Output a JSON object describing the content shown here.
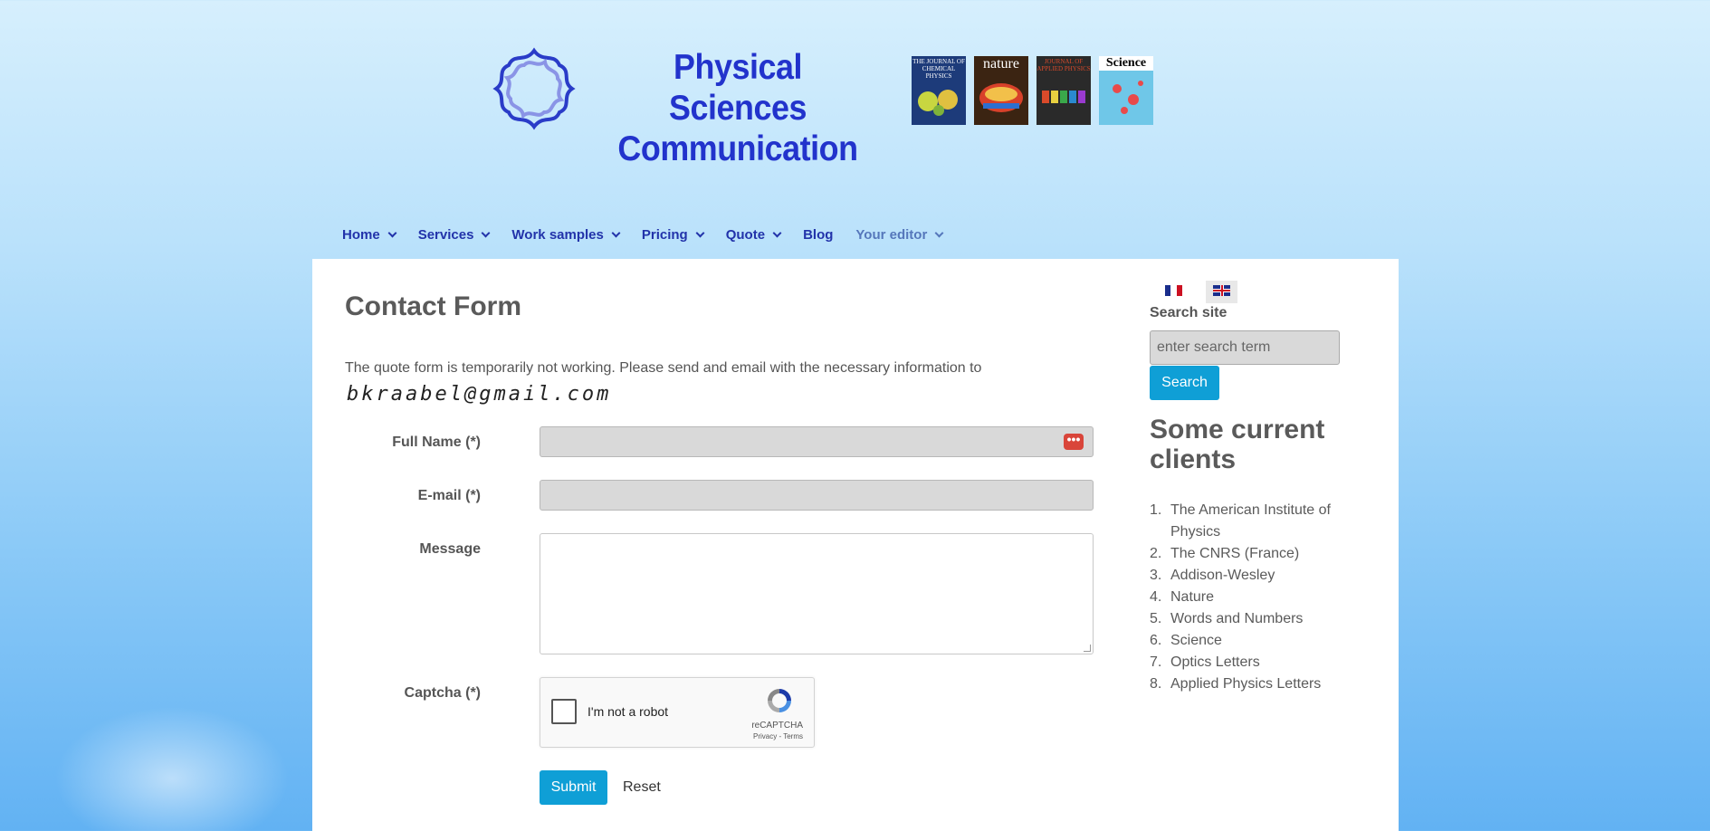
{
  "header": {
    "site_title_line1": "Physical Sciences",
    "site_title_line2": "Communication",
    "covers": [
      {
        "title": "THE JOURNAL OF CHEMICAL PHYSICS",
        "bg": "#1d3b7a",
        "fg": "#ffffff"
      },
      {
        "title": "nature",
        "bg": "#3b2412",
        "fg": "#ffffff"
      },
      {
        "title": "JOURNAL OF APPLIED PHYSICS",
        "bg": "#2a2a2a",
        "fg": "#d94a2a"
      },
      {
        "title": "Science",
        "bg": "#6fc7e8",
        "fg": "#000000"
      }
    ]
  },
  "nav": {
    "items": [
      {
        "label": "Home",
        "has_dropdown": true
      },
      {
        "label": "Services",
        "has_dropdown": true
      },
      {
        "label": "Work samples",
        "has_dropdown": true
      },
      {
        "label": "Pricing",
        "has_dropdown": true
      },
      {
        "label": "Quote",
        "has_dropdown": true
      },
      {
        "label": "Blog",
        "has_dropdown": false
      },
      {
        "label": "Your editor",
        "has_dropdown": true
      }
    ]
  },
  "main": {
    "title": "Contact Form",
    "notice": "The quote form is temporarily not working. Please send and email with the necessary information to",
    "email_image_text": "bkraabel@gmail.com",
    "form": {
      "full_name_label": "Full Name (*)",
      "email_label": "E-mail (*)",
      "message_label": "Message",
      "captcha_label": "Captcha (*)",
      "captcha_checkbox_text": "I'm not a robot",
      "captcha_brand": "reCAPTCHA",
      "captcha_links": "Privacy - Terms",
      "submit_label": "Submit",
      "reset_label": "Reset"
    }
  },
  "sidebar": {
    "languages": [
      "fr",
      "en"
    ],
    "search_label": "Search site",
    "search_placeholder": "enter search term",
    "search_button": "Search",
    "clients_title": "Some current clients",
    "clients": [
      "The American Institute of Physics",
      "The CNRS (France)",
      "Addison-Wesley",
      "Nature",
      "Words and Numbers",
      "Science",
      "Optics Letters",
      "Applied Physics Letters"
    ]
  },
  "colors": {
    "accent": "#0f9fd6",
    "title_blue": "#2233cc",
    "nav_blue": "#2233aa"
  }
}
